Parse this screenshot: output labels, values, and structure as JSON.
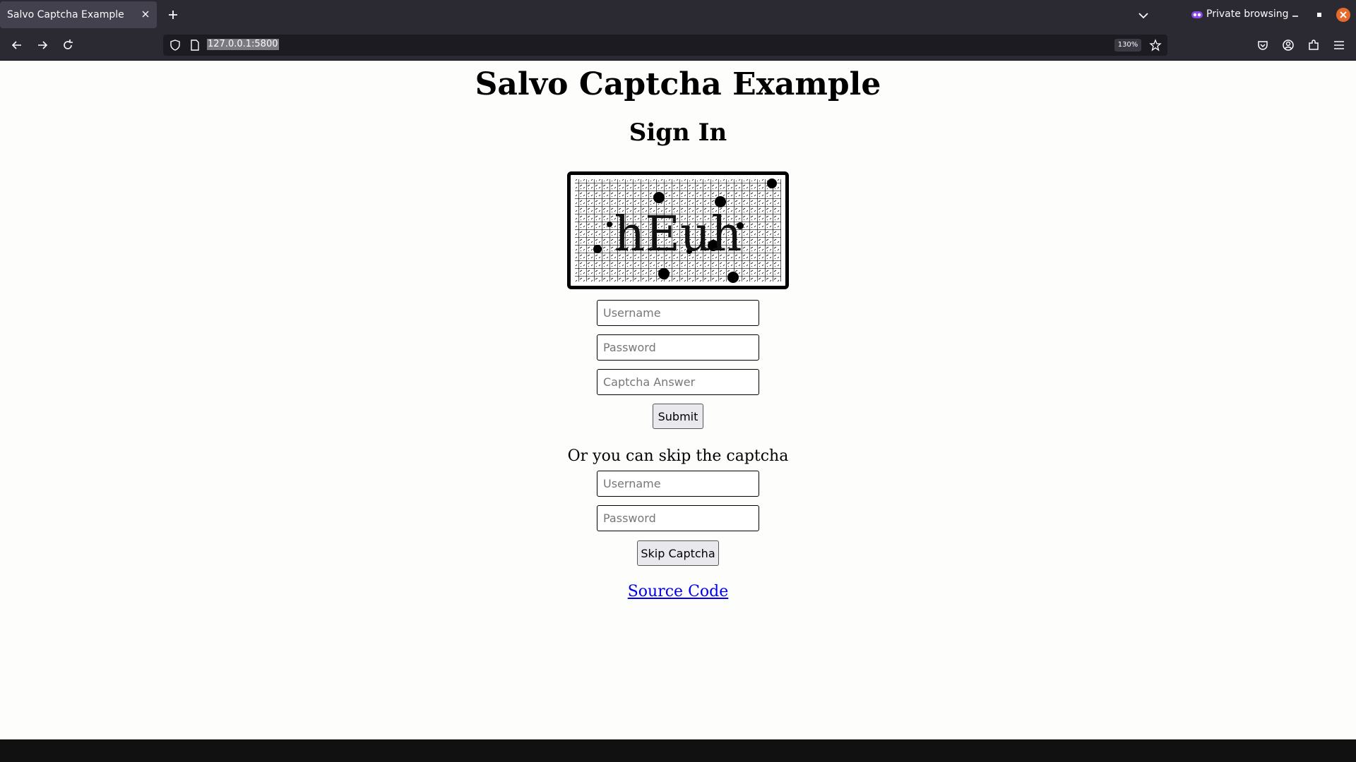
{
  "browser": {
    "tab_title": "Salvo Captcha Example",
    "url": "127.0.0.1:5800",
    "zoom": "130%",
    "private_label": "Private browsing",
    "accent": "#e66a2c"
  },
  "page": {
    "title": "Salvo Captcha Example",
    "subtitle": "Sign In",
    "captcha_text": "hEuh",
    "captcha_form": {
      "username_placeholder": "Username",
      "password_placeholder": "Password",
      "answer_placeholder": "Captcha Answer",
      "submit_label": "Submit"
    },
    "skip_text": "Or you can skip the captcha",
    "skip_form": {
      "username_placeholder": "Username",
      "password_placeholder": "Password",
      "skip_label": "Skip Captcha"
    },
    "source_link": "Source Code",
    "link_color": "#0000ee"
  }
}
